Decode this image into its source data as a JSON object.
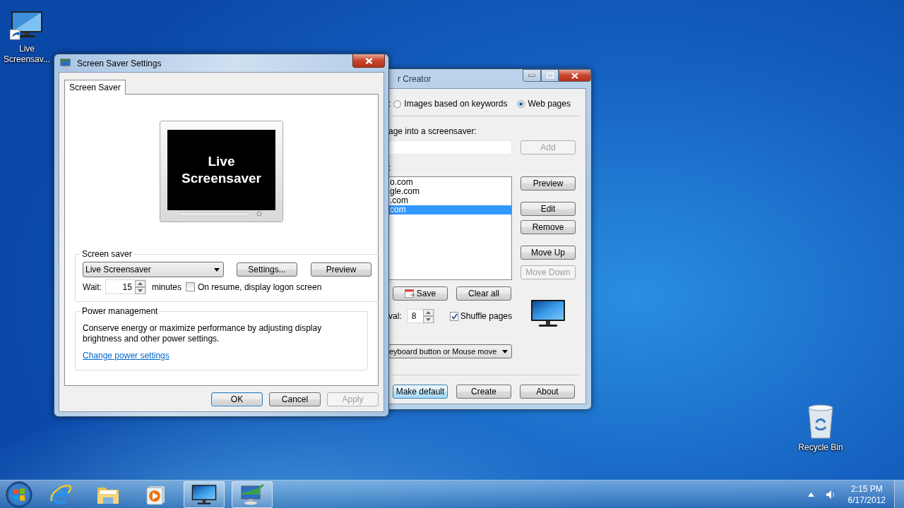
{
  "desktop_icons": [
    {
      "kind": "monitor-shortcut",
      "label": "Live Screensav..."
    },
    {
      "kind": "recycle-bin",
      "label": "Recycle Bin"
    }
  ],
  "creator_window": {
    "title": "r Creator",
    "source_label": ":",
    "source_options": [
      {
        "label": "Images based on keywords",
        "selected": false
      },
      {
        "label": "Web pages",
        "selected": true
      }
    ],
    "add_label": "age into a screensaver:",
    "add_button": {
      "label": "Add",
      "disabled": true
    },
    "pages_label": ":",
    "pages": [
      {
        "label": "o.com",
        "selected": false
      },
      {
        "label": "gle.com",
        "selected": false
      },
      {
        "label": ".com",
        "selected": false
      },
      {
        "label": "com",
        "selected": true
      }
    ],
    "side_buttons": [
      {
        "label": "Preview",
        "disabled": false
      },
      {
        "label": "Edit",
        "disabled": false
      },
      {
        "label": "Remove",
        "disabled": false
      },
      {
        "label": "Move Up",
        "disabled": false
      },
      {
        "label": "Move Down",
        "disabled": true
      }
    ],
    "save_button": "Save",
    "clear_button": "Clear all",
    "interval_label": "val:",
    "interval_value": "8",
    "shuffle": {
      "label": "Shuffle pages",
      "checked": true
    },
    "exit_mode": "eyboard button or Mouse move",
    "bottom_buttons": [
      {
        "label": "Make default",
        "hovered": true
      },
      {
        "label": "Create",
        "hovered": false
      },
      {
        "label": "About",
        "hovered": false
      }
    ]
  },
  "settings_window": {
    "title": "Screen Saver Settings",
    "tabs": [
      {
        "label": "Screen Saver",
        "selected": true
      }
    ],
    "preview_text": "Live Screensaver",
    "screen_saver_group": {
      "title": "Screen saver",
      "selected": "Live Screensaver",
      "buttons": [
        "Settings...",
        "Preview"
      ],
      "wait_label": "Wait:",
      "wait_value": "15",
      "wait_unit": "minutes",
      "logon": {
        "label": "On resume, display logon screen",
        "checked": false
      }
    },
    "power_group": {
      "title": "Power management",
      "description": "Conserve energy or maximize performance by adjusting display brightness and other power settings.",
      "link": "Change power settings"
    },
    "buttons": [
      {
        "label": "OK",
        "default": true,
        "disabled": false
      },
      {
        "label": "Cancel",
        "default": false,
        "disabled": false
      },
      {
        "label": "Apply",
        "default": false,
        "disabled": true
      }
    ]
  },
  "taskbar": {
    "apps": [
      {
        "kind": "browser",
        "active": false
      },
      {
        "kind": "folder",
        "active": false
      },
      {
        "kind": "media",
        "active": false
      },
      {
        "kind": "monitor",
        "active": true
      },
      {
        "kind": "display-settings",
        "active": true
      }
    ],
    "clock": {
      "time": "2:15 PM",
      "date": "6/17/2012"
    }
  }
}
